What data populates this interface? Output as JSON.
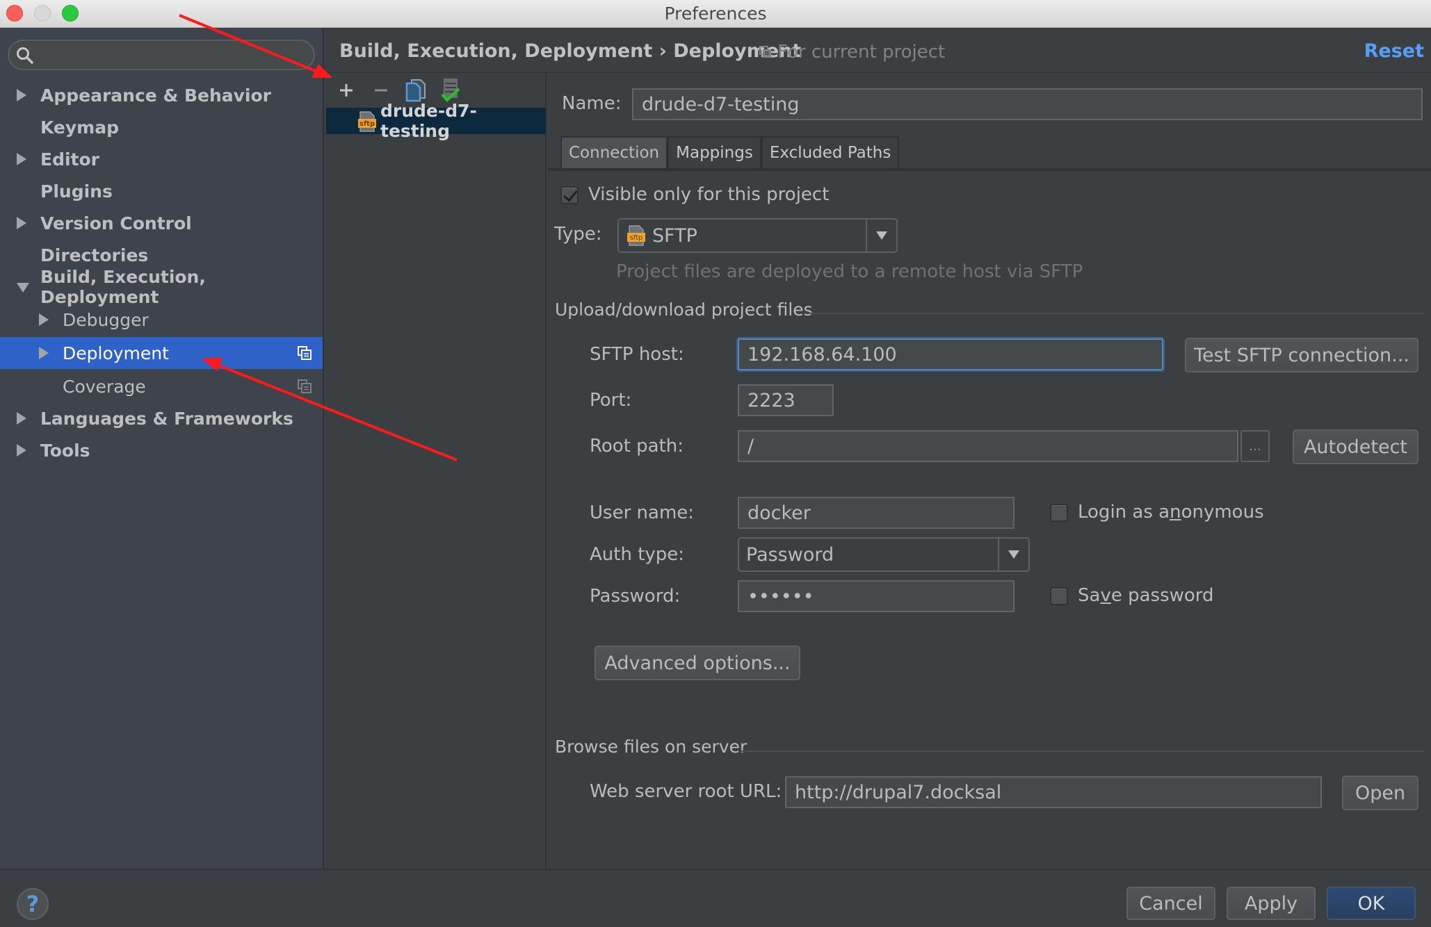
{
  "window": {
    "title": "Preferences",
    "traffic_lights": [
      "close",
      "minimize",
      "maximize"
    ]
  },
  "sidebar": {
    "search": {
      "value": "",
      "placeholder": ""
    },
    "items": [
      {
        "label": "Appearance & Behavior",
        "level": 0,
        "expandable": true,
        "expanded": false
      },
      {
        "label": "Keymap",
        "level": 0,
        "expandable": false
      },
      {
        "label": "Editor",
        "level": 0,
        "expandable": true,
        "expanded": false
      },
      {
        "label": "Plugins",
        "level": 0,
        "expandable": false
      },
      {
        "label": "Version Control",
        "level": 0,
        "expandable": true,
        "expanded": false
      },
      {
        "label": "Directories",
        "level": 0,
        "expandable": false
      },
      {
        "label": "Build, Execution, Deployment",
        "level": 0,
        "expandable": true,
        "expanded": true
      },
      {
        "label": "Debugger",
        "level": 1,
        "expandable": true,
        "expanded": false
      },
      {
        "label": "Deployment",
        "level": 1,
        "expandable": true,
        "expanded": false,
        "selected": true,
        "project_icon": true
      },
      {
        "label": "Coverage",
        "level": 1,
        "expandable": false,
        "project_icon": true
      },
      {
        "label": "Languages & Frameworks",
        "level": 0,
        "expandable": true,
        "expanded": false
      },
      {
        "label": "Tools",
        "level": 0,
        "expandable": true,
        "expanded": false
      }
    ]
  },
  "header": {
    "breadcrumb": "Build, Execution, Deployment › Deployment",
    "scope_note": "For current project",
    "reset_label": "Reset"
  },
  "servers": {
    "toolbar": [
      "add-icon",
      "remove-icon",
      "copy-icon",
      "use-as-default-icon"
    ],
    "items": [
      {
        "name": "drude-d7-testing",
        "type_badge": "sftp",
        "selected": true
      }
    ]
  },
  "form": {
    "name_label": "Name:",
    "name_value": "drude-d7-testing",
    "tabs": [
      {
        "label": "Connection",
        "active": true
      },
      {
        "label": "Mappings",
        "active": false
      },
      {
        "label": "Excluded Paths",
        "active": false
      }
    ],
    "visible_only_label": "Visible only for this project",
    "visible_only_checked": true,
    "type_label": "Type:",
    "type_value": "SFTP",
    "type_badge": "sftp",
    "type_hint": "Project files are deployed to a remote host via SFTP",
    "upload_section": "Upload/download project files",
    "host_label": "SFTP host:",
    "host_value": "192.168.64.100",
    "test_button": "Test SFTP connection...",
    "port_label": "Port:",
    "port_value": "2223",
    "root_label": "Root path:",
    "root_value": "/",
    "browse_label": "...",
    "autodetect_button": "Autodetect",
    "user_label": "User name:",
    "user_value": "docker",
    "anonymous_label_pre": "Login as a",
    "anonymous_label_mn": "n",
    "anonymous_label_post": "onymous",
    "anonymous_checked": false,
    "auth_label": "Auth type:",
    "auth_value": "Password",
    "password_label": "Password:",
    "password_value": "••••••",
    "save_pw_label_pre": "Sa",
    "save_pw_label_mn": "v",
    "save_pw_label_post": "e password",
    "save_pw_checked": false,
    "advanced_button": "Advanced options...",
    "browse_section": "Browse files on server",
    "weburl_label": "Web server root URL:",
    "weburl_value": "http://drupal7.docksal",
    "open_button": "Open"
  },
  "footer": {
    "help_label": "?",
    "cancel": "Cancel",
    "apply": "Apply",
    "ok": "OK"
  },
  "annotations": {
    "arrow_color": "#ff1a1a",
    "arrows": [
      "points-to-add-server-button",
      "points-to-deployment-item"
    ]
  }
}
